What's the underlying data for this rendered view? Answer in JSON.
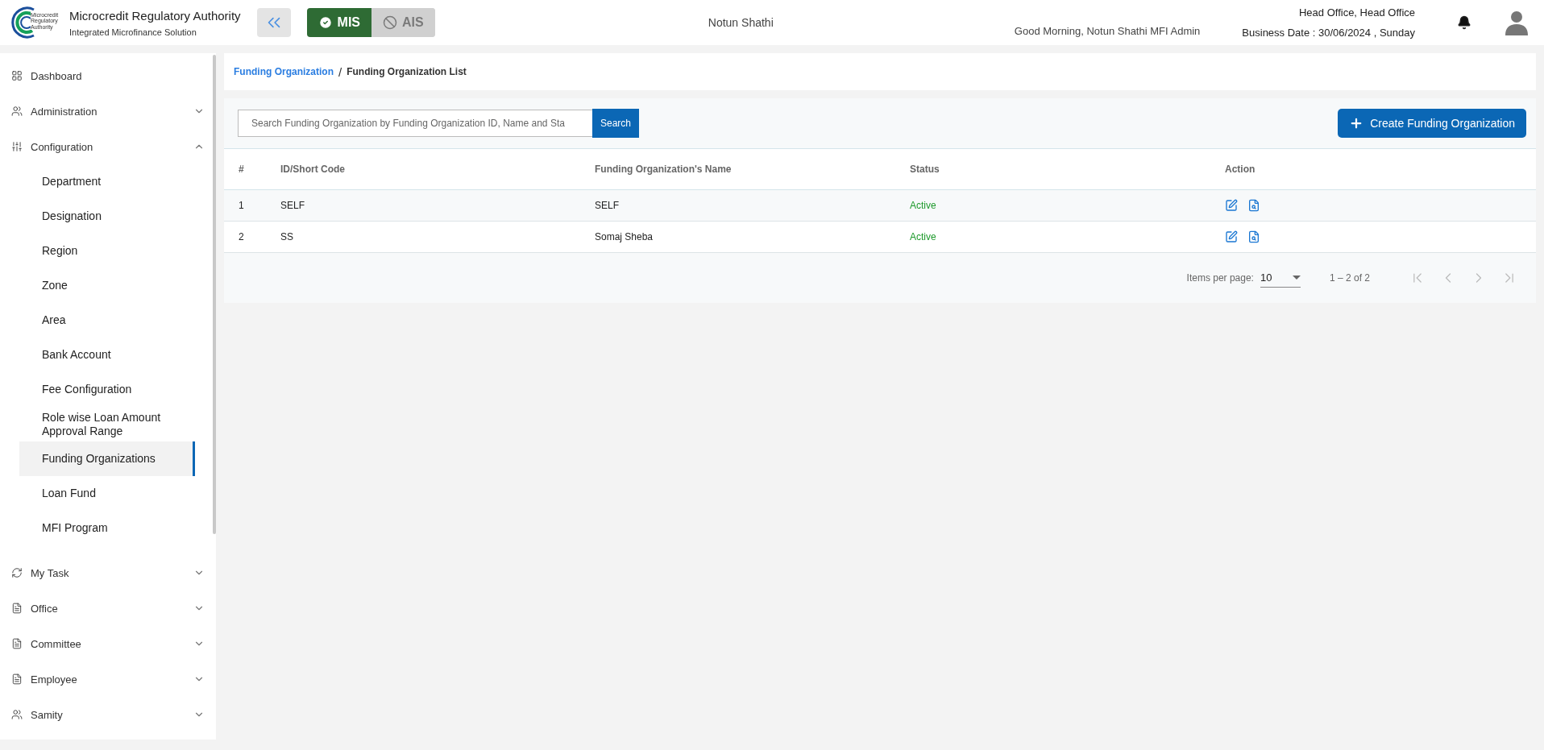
{
  "header": {
    "logo_text": "Microcredit Regulatory Authority",
    "title": "Microcredit Regulatory Authority",
    "subtitle": "Integrated Microfinance Solution",
    "modules": [
      {
        "label": "MIS",
        "selected": true
      },
      {
        "label": "AIS",
        "selected": false
      }
    ],
    "organization": "Notun Shathi",
    "greeting": "Good Morning, Notun Shathi MFI Admin",
    "office": "Head Office, Head Office",
    "business_date": "Business Date : 30/06/2024 , Sunday"
  },
  "sidebar": {
    "items": [
      {
        "label": "Dashboard"
      },
      {
        "label": "Administration",
        "expanded": false
      },
      {
        "label": "Configuration",
        "expanded": true,
        "children": [
          {
            "label": "Department",
            "selected": false
          },
          {
            "label": "Designation",
            "selected": false
          },
          {
            "label": "Region",
            "selected": false
          },
          {
            "label": "Zone",
            "selected": false
          },
          {
            "label": "Area",
            "selected": false
          },
          {
            "label": "Bank Account",
            "selected": false
          },
          {
            "label": "Fee Configuration",
            "selected": false
          },
          {
            "label": "Role wise Loan Amount Approval Range",
            "selected": false
          },
          {
            "label": "Funding Organizations",
            "selected": true
          },
          {
            "label": "Loan Fund",
            "selected": false
          },
          {
            "label": "MFI Program",
            "selected": false
          }
        ]
      },
      {
        "label": "My Task",
        "expanded": false
      },
      {
        "label": "Office",
        "expanded": false
      },
      {
        "label": "Committee",
        "expanded": false
      },
      {
        "label": "Employee",
        "expanded": false
      },
      {
        "label": "Samity",
        "expanded": false
      }
    ]
  },
  "breadcrumb": {
    "link": "Funding Organization",
    "separator": "/",
    "current": "Funding Organization List"
  },
  "search": {
    "placeholder": "Search Funding Organization by Funding Organization ID, Name and Sta",
    "button": "Search"
  },
  "create_button": "Create Funding Organization",
  "table": {
    "columns": [
      "#",
      "ID/Short Code",
      "Funding Organization's Name",
      "Status",
      "Action"
    ],
    "rows": [
      {
        "index": "1",
        "code": "SELF",
        "name": "SELF",
        "status": "Active",
        "active": true
      },
      {
        "index": "2",
        "code": "SS",
        "name": "Somaj Sheba",
        "status": "Active",
        "active": true
      }
    ]
  },
  "paginator": {
    "label": "Items per page:",
    "page_size": "10",
    "range": "1 – 2 of 2"
  }
}
